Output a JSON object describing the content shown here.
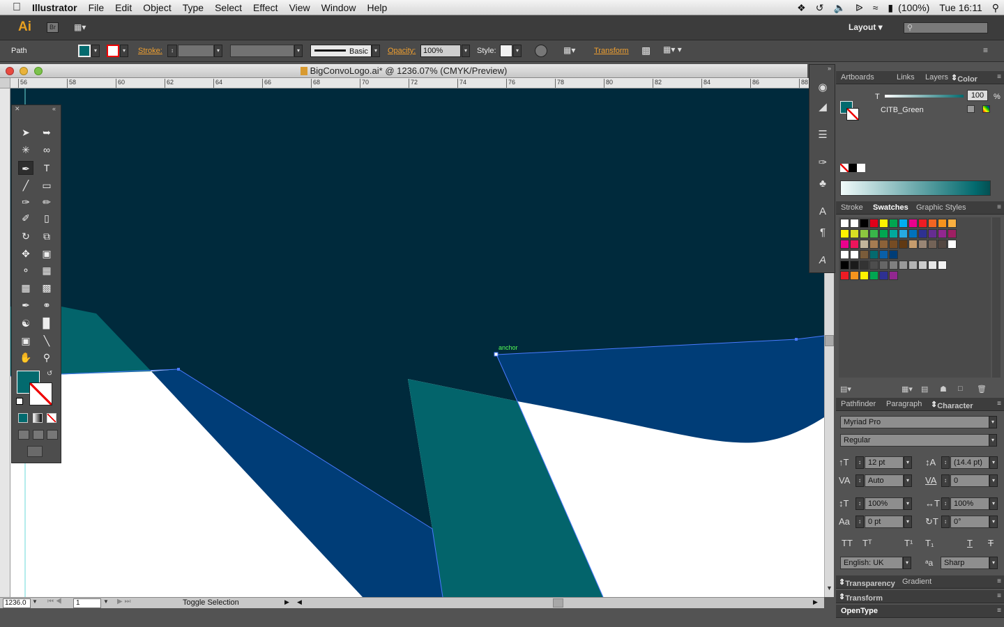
{
  "menubar": {
    "app_name": "Illustrator",
    "menus": [
      "File",
      "Edit",
      "Object",
      "Type",
      "Select",
      "Effect",
      "View",
      "Window",
      "Help"
    ],
    "battery": "(100%)",
    "clock": "Tue 16:11"
  },
  "appbar": {
    "logo": "Ai",
    "bridge_label": "Br",
    "workspace": "Layout",
    "search_placeholder": ""
  },
  "control_bar": {
    "selection_type": "Path",
    "stroke_label": "Stroke:",
    "brush_label": "Basic",
    "opacity_label": "Opacity:",
    "opacity_value": "100%",
    "style_label": "Style:",
    "transform_link": "Transform"
  },
  "document": {
    "title": "BigConvoLogo.ai* @ 1236.07% (CMYK/Preview)",
    "ruler_ticks": [
      "56",
      "58",
      "60",
      "62",
      "64",
      "66",
      "68",
      "70",
      "72",
      "74",
      "76",
      "78",
      "80",
      "82",
      "84",
      "86",
      "88"
    ],
    "anchor_label": "anchor",
    "colors": {
      "dark_navy": "#002a3c",
      "teal": "#03646b",
      "blue": "#003d77",
      "white": "#ffffff"
    }
  },
  "statusbar": {
    "zoom": "1236.0",
    "artboard": "1",
    "status_text": "Toggle Selection"
  },
  "color_panel": {
    "tabs": [
      "Artboards",
      "Links",
      "Layers",
      "Color"
    ],
    "active_tab": "Color",
    "tint_label": "T",
    "tint_value": "100",
    "percent": "%",
    "swatch_name": "CITB_Green",
    "fill_color": "#036a6e"
  },
  "swatches_panel": {
    "tabs": [
      "Stroke",
      "Swatches",
      "Graphic Styles"
    ],
    "active_tab": "Swatches",
    "rows": [
      [
        "#ffffff",
        "#ffffff",
        "#000000",
        "#e0001a",
        "#fff200",
        "#00a650",
        "#00aeef",
        "#ec008c",
        "#ed1c24",
        "#f26522",
        "#f7941d",
        "#fbb040"
      ],
      [
        "#fff200",
        "#d7df23",
        "#8dc63f",
        "#39b54a",
        "#00a651",
        "#00a99d",
        "#27aae1",
        "#0072bc",
        "#2e3192",
        "#662d91",
        "#92278f",
        "#9e1f63"
      ],
      [
        "#ec008c",
        "#ed145b",
        "#c2b59b",
        "#a67c52",
        "#8c6239",
        "#754c24",
        "#603913",
        "#c69c6d",
        "#998675",
        "#736357",
        "#534741",
        "#ffffff"
      ],
      [
        "#ffffff",
        "#ffffff",
        "#7a5c3a",
        "#056a6e",
        "#0a5fa8",
        "#003d77"
      ],
      [
        "#000000",
        "#1a1a1a",
        "#333333",
        "#4d4d4d",
        "#666666",
        "#808080",
        "#999999",
        "#b3b3b3",
        "#cccccc",
        "#e6e6e6",
        "#f2f2f2"
      ],
      [
        "#ed1c24",
        "#f7941d",
        "#fff200",
        "#00a651",
        "#2e3192",
        "#92278f"
      ]
    ]
  },
  "character_panel": {
    "tabs": [
      "Pathfinder",
      "Paragraph",
      "Character"
    ],
    "active_tab": "Character",
    "font_family": "Myriad Pro",
    "font_style": "Regular",
    "font_size": "12 pt",
    "leading": "(14.4 pt)",
    "kerning": "Auto",
    "tracking": "0",
    "vertical_scale": "100%",
    "horizontal_scale": "100%",
    "baseline_shift": "0 pt",
    "rotation": "0°",
    "language": "English: UK",
    "antialias": "Sharp"
  },
  "collapsed_panels": [
    {
      "tabs": [
        "Transparency",
        "Gradient"
      ]
    },
    {
      "tabs": [
        "Transform"
      ]
    },
    {
      "tabs": [
        "OpenType"
      ]
    }
  ]
}
